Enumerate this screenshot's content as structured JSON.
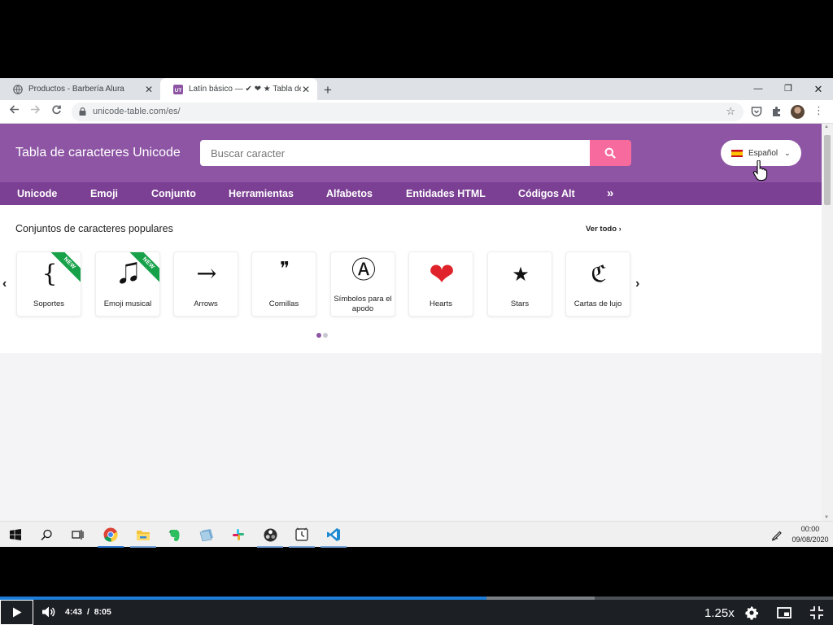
{
  "browser": {
    "tabs": [
      {
        "title": "Productos - Barbería Alura",
        "active": false
      },
      {
        "title": "Latín básico — ✔ ❤ ★ Tabla de caracteres",
        "active": true
      }
    ],
    "url": "unicode-table.com/es/"
  },
  "site": {
    "brand": "Tabla de caracteres Unicode",
    "search_placeholder": "Buscar caracter",
    "language": "Español",
    "nav": [
      "Unicode",
      "Emoji",
      "Conjunto",
      "Herramientas",
      "Alfabetos",
      "Entidades HTML",
      "Códigos Alt",
      "»"
    ],
    "section_title": "Conjuntos de caracteres populares",
    "see_all": "Ver todo",
    "cards": [
      {
        "glyph": "{",
        "label": "Soportes",
        "badge": "NEW"
      },
      {
        "glyph": "🎜",
        "label": "Emoji musical",
        "badge": "NEW"
      },
      {
        "glyph": "→",
        "label": "Arrows",
        "badge": ""
      },
      {
        "glyph": "❞",
        "label": "Comillas",
        "badge": ""
      },
      {
        "glyph": "Ⓐ",
        "label": "Símbolos para el apodo",
        "badge": ""
      },
      {
        "glyph": "❤",
        "label": "Hearts",
        "badge": ""
      },
      {
        "glyph": "★",
        "label": "Stars",
        "badge": ""
      },
      {
        "glyph": "ℭ",
        "label": "Cartas de lujo",
        "badge": ""
      }
    ],
    "carousel_pages": 2,
    "carousel_active_page": 1
  },
  "taskbar": {
    "icons": [
      "start-icon",
      "search-icon",
      "task-view-icon",
      "chrome-icon",
      "file-explorer-icon",
      "evernote-icon",
      "notes-icon",
      "slack-icon",
      "obs-icon",
      "clock-app-icon",
      "vscode-icon"
    ],
    "time": "00:00",
    "date": "09/08/2020"
  },
  "player": {
    "current_time": "4:43",
    "separator": "/",
    "duration": "8:05",
    "progress_fraction": 0.584,
    "speed": "1.25x"
  },
  "colors": {
    "header": "#8d55a4",
    "nav": "#7b3f93",
    "search_button": "#f76a9e",
    "badge": "#17a24a",
    "progress": "#1c7cd6"
  }
}
